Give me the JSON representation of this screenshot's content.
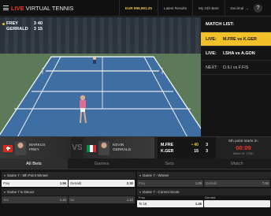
{
  "header": {
    "brand_live": "LIVE",
    "brand_rest": "VIRTUAL TENNIS",
    "balance": "EUR 999,981.25",
    "nav": [
      "Latest Results",
      "My 24h Bets",
      "Decimal"
    ],
    "decimal_caret": "⌄",
    "help_label": "?"
  },
  "video_score": {
    "rows": [
      {
        "name": "FREY",
        "points": "3",
        "games": "40",
        "serving": true
      },
      {
        "name": "GERRALD",
        "points": "3",
        "games": "15",
        "serving": false
      }
    ]
  },
  "match_list": {
    "title": "MATCH LIST:",
    "items": [
      {
        "tag": "LIVE:",
        "match": "M.FRE vs K.GER",
        "active": true
      },
      {
        "tag": "LIVE:",
        "match": "I.SHA vs A.GON",
        "active": false
      },
      {
        "tag": "NEXT:",
        "match": "D.ILI vs F.FIS",
        "active": false
      }
    ]
  },
  "scoreboard": {
    "left_player": {
      "first": "MARKUS",
      "last": "FREY",
      "flag": "switzerland"
    },
    "vs": "VS",
    "right_player": {
      "first": "KEVIN",
      "last": "GERRALD",
      "flag": "italy"
    },
    "mini": [
      {
        "name": "M.FRE",
        "points": "40",
        "games": "3",
        "serving": true
      },
      {
        "name": "K.GER",
        "points": "15",
        "games": "3",
        "serving": false
      }
    ],
    "next_title": "5th point starts in:",
    "timer": "00:09",
    "match_id": "Match ID: 17281"
  },
  "tabs": [
    "All Bets",
    "Games",
    "Sets",
    "Match"
  ],
  "markets": {
    "left": [
      {
        "title": "Game 7 - 5th Point Winner",
        "options": [
          {
            "label": "Frey",
            "odd": "1.56"
          },
          {
            "label": "Gerrald",
            "odd": "2.30"
          }
        ],
        "dim": false
      },
      {
        "title": "Game 7 to Deuce",
        "options": [
          {
            "label": "Yes",
            "odd": "1.44"
          },
          {
            "label": "No",
            "odd": "1.12"
          }
        ],
        "dim": true
      }
    ],
    "right": [
      {
        "title": "Game 7 - Winner",
        "options": [
          {
            "label": "Frey",
            "odd": "1.09"
          },
          {
            "label": "Gerrald",
            "odd": "7.50"
          }
        ],
        "dim": true
      },
      {
        "title": "Game 7 - Correct Score",
        "col_labels": [
          "Frey",
          "Gerrald"
        ],
        "options": [
          {
            "label": "To 15",
            "odd": "1.46"
          },
          {
            "label": "",
            "odd": ""
          }
        ],
        "dim": false
      }
    ]
  },
  "colors": {
    "accent": "#f2c12a",
    "live_red": "#e8392b"
  }
}
